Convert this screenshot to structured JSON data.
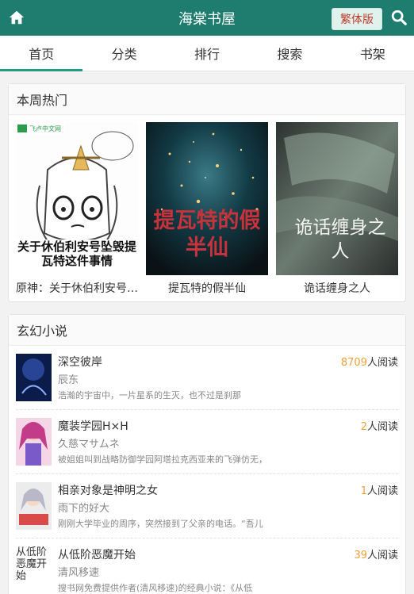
{
  "header": {
    "title": "海棠书屋",
    "trad_label": "繁体版"
  },
  "nav": {
    "tabs": [
      {
        "label": "首页"
      },
      {
        "label": "分类"
      },
      {
        "label": "排行"
      },
      {
        "label": "搜索"
      },
      {
        "label": "书架"
      }
    ]
  },
  "hot": {
    "title": "本周热门",
    "books": [
      {
        "name": "原神：关于休伯利安号坠毁提瓦特这件事情",
        "cover_text": "关于休伯利安号坠毁提瓦特这件事情",
        "cover_brand": "飞卢中文网"
      },
      {
        "name": "提瓦特的假半仙",
        "cover_text": "提瓦特的假半仙"
      },
      {
        "name": "诡话缠身之人",
        "cover_text": "诡话缠身之人"
      }
    ]
  },
  "xuanhuan": {
    "title": "玄幻小说",
    "read_suffix": "人阅读",
    "items": [
      {
        "name": "深空彼岸",
        "reads": "8709",
        "author": "辰东",
        "intro": "浩瀚的宇宙中，一片星系的生灭，也不过是刹那"
      },
      {
        "name": "魔装学园H×H",
        "reads": "2",
        "author": "久慈マサムネ",
        "intro": "被姐姐叫到战略防御学园阿塔拉克西亚来的飞弹仿无，"
      },
      {
        "name": "相亲对象是神明之女",
        "reads": "1",
        "author": "雨下的好大",
        "intro": "刚刚大学毕业的周序，突然接到了父亲的电话。“吾儿"
      },
      {
        "name": "从低阶恶魔开始",
        "reads": "39",
        "author": "清风移速",
        "intro": "搜书网免费提供作者(清风移速)的经典小说：《从低",
        "thumb_alt": "从低阶恶魔开始"
      }
    ]
  },
  "colors": {
    "brand": "#1f7d6f",
    "accent": "#1f9d83",
    "reads_number": "#f0a03a"
  }
}
